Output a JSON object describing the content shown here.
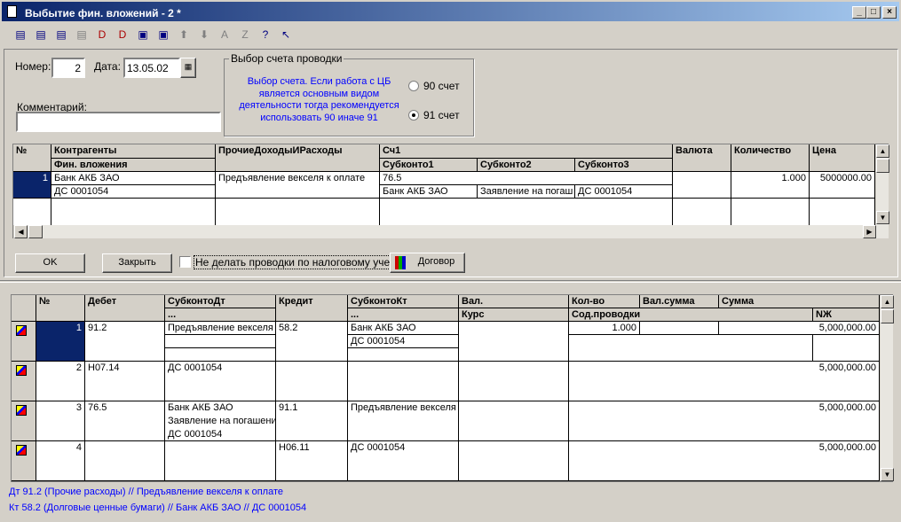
{
  "window": {
    "title": "Выбытие фин. вложений - 2 *",
    "controls": [
      "_",
      "□",
      "×"
    ]
  },
  "toolbar": [
    "new-row",
    "add-row",
    "delete-row",
    "copy-row",
    "dt-kt-1",
    "dt-kt-2",
    "move-left",
    "move-right",
    "up",
    "down",
    "sort-asc",
    "sort-desc",
    "help",
    "context-help"
  ],
  "form": {
    "number_label": "Номер:",
    "number": "2",
    "date_label": "Дата:",
    "date": "13.05.02",
    "comment_label": "Комментарий:",
    "comment": ""
  },
  "account_choice": {
    "legend": "Выбор счета проводки",
    "hint": "Выбор счета. Если работа с ЦБ является основным видом деятельности тогда рекомендуется использовать 90 иначе 91",
    "option_90": "90 счет",
    "option_91": "91 счет",
    "selected": "91"
  },
  "upper_table": {
    "headers": {
      "num": "№",
      "contragents": "Контрагенты",
      "fin": "Фин. вложения",
      "other": "ПрочиеДоходыИРасходы",
      "sch1": "Сч1",
      "sub1": "Субконто1",
      "sub2": "Субконто2",
      "sub3": "Субконто3",
      "currency": "Валюта",
      "qty": "Количество",
      "price": "Цена"
    },
    "rows": [
      {
        "num": "1",
        "contragent": "Банк АКБ ЗАО",
        "fin": "ДС 0001054",
        "other": "Предъявление векселя к оплате",
        "sch1": "76.5",
        "sub1": "Банк АКБ ЗАО",
        "sub2": "Заявление на погаш",
        "sub3": "ДС 0001054",
        "currency": "",
        "qty": "1.000",
        "price": "5000000.00"
      }
    ]
  },
  "buttons": {
    "ok": "OK",
    "close": "Закрыть",
    "no_tax": "Не делать проводки по налоговому учету",
    "contract": "Договор"
  },
  "lower_table": {
    "headers": {
      "num": "№",
      "debit": "Дебет",
      "subdt": "СубконтоДт",
      "subdt2": "...",
      "credit": "Кредит",
      "subkt": "СубконтоКт",
      "subkt2": "...",
      "val": "Вал.",
      "rate": "Курс",
      "qty": "Кол-во",
      "valsum": "Вал.сумма",
      "sum": "Сумма",
      "content": "Сод.проводки",
      "nj": "NЖ"
    },
    "rows": [
      {
        "num": "1",
        "debit": "91.2",
        "subdt": [
          "Предъявление векселя",
          "",
          ""
        ],
        "credit": "58.2",
        "subkt": [
          "Банк АКБ ЗАО",
          "ДС 0001054",
          ""
        ],
        "qty": "1.000",
        "sum": "5,000,000.00"
      },
      {
        "num": "2",
        "debit": "Н07.14",
        "subdt": [
          "ДС 0001054"
        ],
        "credit": "",
        "subkt": [
          ""
        ],
        "qty": "",
        "sum": "5,000,000.00"
      },
      {
        "num": "3",
        "debit": "76.5",
        "subdt": [
          "Банк АКБ ЗАО",
          "Заявление на погашени",
          "ДС 0001054"
        ],
        "credit": "91.1",
        "subkt": [
          "Предъявление векселя"
        ],
        "qty": "",
        "sum": "5,000,000.00"
      },
      {
        "num": "4",
        "debit": "",
        "subdt": [
          ""
        ],
        "credit": "Н06.11",
        "subkt": [
          "ДС 0001054"
        ],
        "qty": "",
        "sum": "5,000,000.00"
      }
    ]
  },
  "status": {
    "line1": "Дт 91.2 (Прочие расходы) // Предъявление векселя к оплате",
    "line2": "Кт 58.2 (Долговые ценные бумаги) // Банк АКБ ЗАО  // ДС 0001054"
  }
}
